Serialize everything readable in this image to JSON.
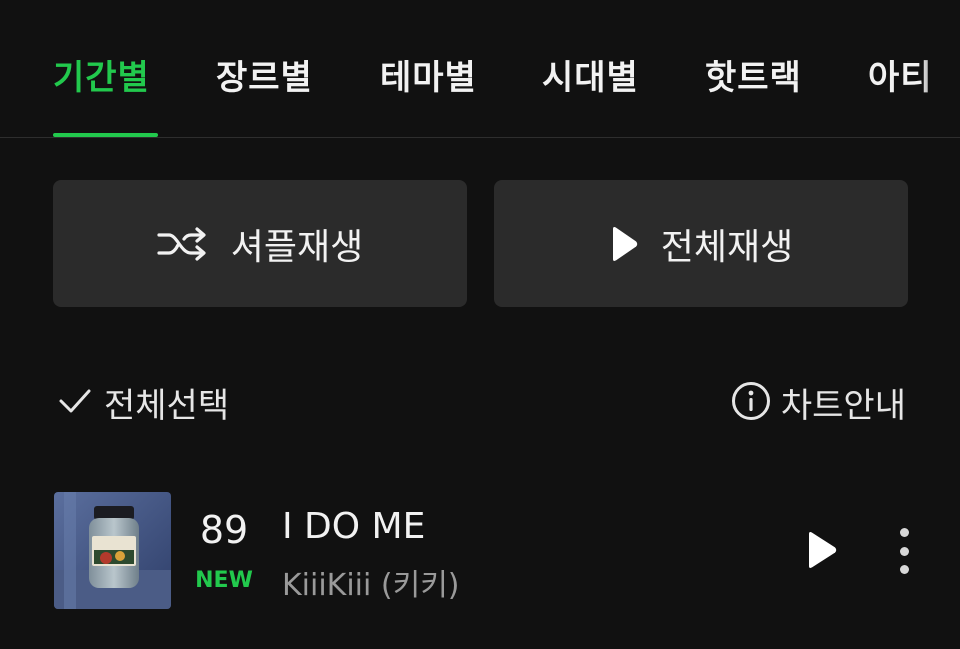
{
  "tabs": [
    {
      "label": "기간별",
      "active": true
    },
    {
      "label": "장르별",
      "active": false
    },
    {
      "label": "테마별",
      "active": false
    },
    {
      "label": "시대별",
      "active": false
    },
    {
      "label": "핫트랙",
      "active": false
    },
    {
      "label": "아티",
      "active": false
    }
  ],
  "actions": {
    "shuffle_label": "셔플재생",
    "play_all_label": "전체재생"
  },
  "toolbar": {
    "select_all_label": "전체선택",
    "chart_info_label": "차트안내"
  },
  "tracks": [
    {
      "rank": "89",
      "badge": "NEW",
      "title": "I DO ME",
      "artist": "KiiiKiii (키키)"
    }
  ],
  "colors": {
    "accent": "#22c94d",
    "background": "#111111",
    "button": "#2b2b2b"
  },
  "icons": [
    "shuffle-icon",
    "play-icon",
    "check-icon",
    "info-icon",
    "more-vertical-icon"
  ]
}
